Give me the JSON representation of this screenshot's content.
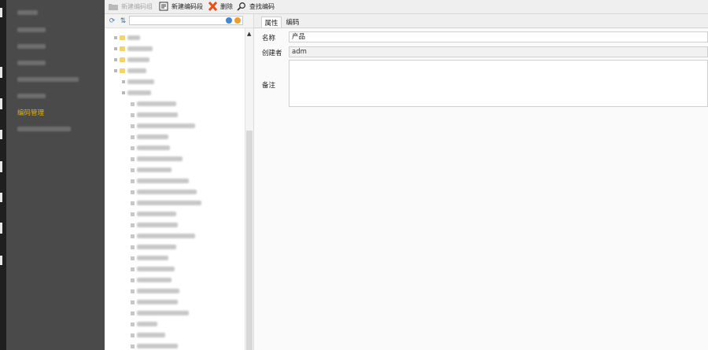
{
  "toolbar": {
    "new_group": "新建编码组",
    "new_segment": "新建编码段",
    "delete": "删除",
    "find": "查找编码"
  },
  "sidebar": {
    "active_item": "编码管理"
  },
  "tree": {
    "search_value": ""
  },
  "detail": {
    "tabs": [
      "属性",
      "编码"
    ],
    "fields": {
      "name_label": "名称",
      "name_value": "产品",
      "creator_label": "创建者",
      "creator_value": "adm",
      "remark_label": "备注",
      "remark_value": ""
    }
  },
  "colors": {
    "sidebar_bg": "#4a4a4a",
    "active_text": "#e8b000",
    "folder": "#f2d36c"
  }
}
